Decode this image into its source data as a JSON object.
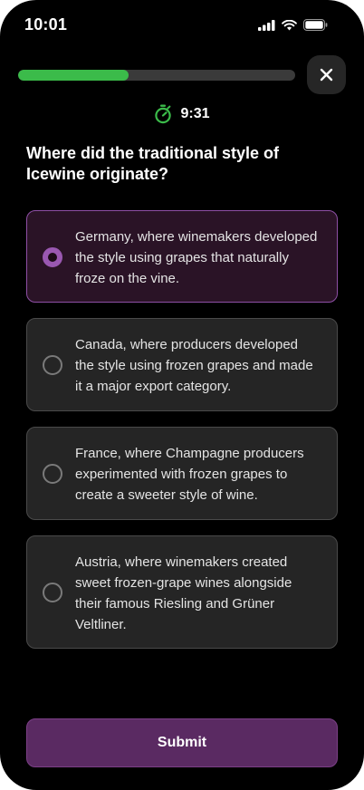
{
  "status_bar": {
    "time": "10:01",
    "icons": [
      "cellular-signal-icon",
      "wifi-icon",
      "battery-icon"
    ]
  },
  "quiz": {
    "progress": 0.4,
    "timer": "9:31",
    "timer_icon": "stopwatch-icon",
    "close_icon": "close-icon",
    "question": "Where did the traditional style of Icewine originate?",
    "options": [
      {
        "text": "Germany, where winemakers developed the style using grapes that naturally froze on the vine.",
        "selected": true
      },
      {
        "text": "Canada, where producers developed the style using frozen grapes and made it a major export category.",
        "selected": false
      },
      {
        "text": "France, where Champagne producers experimented with frozen grapes to create a sweeter style of wine.",
        "selected": false
      },
      {
        "text": "Austria, where winemakers created sweet frozen-grape wines alongside their famous Riesling and Grüner Veltliner.",
        "selected": false
      }
    ],
    "submit_label": "Submit"
  },
  "colors": {
    "background": "#000000",
    "progress": "#3bbb4a",
    "timer_icon": "#3bbb4a",
    "selected_accent": "#9a58b1",
    "submit_background": "#5a2a62"
  }
}
